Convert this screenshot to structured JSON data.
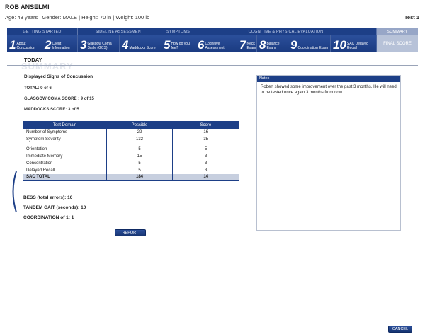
{
  "patient": {
    "name": "ROB ANSELMI",
    "info": "Age: 43 years | Gender: MALE | Height: 70 in | Weight: 100 lb",
    "test_label": "Test 1"
  },
  "nav": {
    "groups": [
      "Getting Started",
      "Sideline Assessment",
      "Symptoms",
      "Cognitive & Physical Evaluation",
      "Summary"
    ],
    "steps": [
      {
        "num": "1",
        "label": "About Concussion"
      },
      {
        "num": "2",
        "label": "Client Information"
      },
      {
        "num": "3",
        "label": "Glasgow Coma Scale (GCS)"
      },
      {
        "num": "4",
        "label": "Maddocks Score"
      },
      {
        "num": "5",
        "label": "How do you feel?"
      },
      {
        "num": "6",
        "label": "Cognitive Assessment"
      },
      {
        "num": "7",
        "label": "Neck Exam"
      },
      {
        "num": "8",
        "label": "Balance Exam"
      },
      {
        "num": "9",
        "label": "Coordination Exam"
      },
      {
        "num": "10",
        "label": "SAC Delayed Recall"
      },
      {
        "num": "",
        "label": "FINAL SCORE"
      }
    ]
  },
  "section": {
    "today": "TODAY",
    "watermark": "SUMMARY"
  },
  "summary": {
    "heading": "Displayed Signs of Concussion",
    "total": "TOTAL: 0 of 6",
    "glasgow": "GLASGOW COMA SCORE : 9 of 15",
    "maddocks": "MADDOCKS SCORE: 3 of 5"
  },
  "table": {
    "headers": [
      "Test Domain",
      "Possible",
      "Score"
    ],
    "rows": [
      {
        "domain": "Number of Symptoms",
        "possible": "22",
        "score": "16"
      },
      {
        "domain": "Symptom Severity",
        "possible": "132",
        "score": "35"
      },
      {
        "domain": "Orientation",
        "possible": "5",
        "score": "5"
      },
      {
        "domain": "Immediate Memory",
        "possible": "15",
        "score": "3"
      },
      {
        "domain": "Concentration",
        "possible": "5",
        "score": "3"
      },
      {
        "domain": "Delayed Recall",
        "possible": "5",
        "score": "3"
      }
    ],
    "total": {
      "domain": "SAC TOTAL",
      "possible": "184",
      "score": "14"
    }
  },
  "results": {
    "bess": "BESS (total errors):  10",
    "tandem": "TANDEM GAIT (seconds):  10",
    "coordination": "COORDINATION of 1:  1"
  },
  "buttons": {
    "report": "REPORT",
    "cancel": "CANCEL"
  },
  "notes": {
    "title": "Notes",
    "text": "Robert showed some improvement over the past 3 months. He will need to be tested once again 3 months from now."
  },
  "colors": {
    "nav_blue": "#1d3f87",
    "summary_tab": "#97a6c7",
    "final_score_tab": "#b7c2d8"
  }
}
